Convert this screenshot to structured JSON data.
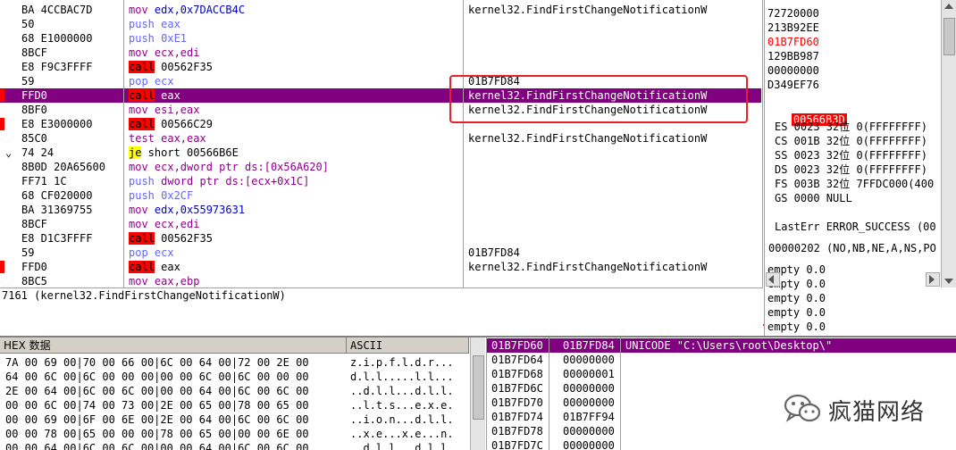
{
  "disasm": {
    "rows": [
      {
        "addr_hex": "BA 4CCBAC7D",
        "instr": [
          [
            "mov ",
            "kw"
          ],
          [
            "edx,0x7DACCB4C",
            "blue"
          ]
        ],
        "comment": "kernel32.FindFirstChangeNotificationW",
        "bp": false,
        "sel": false
      },
      {
        "addr_hex": "50",
        "instr": [
          [
            "push eax",
            "push"
          ]
        ],
        "comment": "",
        "bp": false,
        "sel": false
      },
      {
        "addr_hex": "68 E1000000",
        "instr": [
          [
            "push 0xE1",
            "push"
          ]
        ],
        "comment": "",
        "bp": false,
        "sel": false
      },
      {
        "addr_hex": "8BCF",
        "instr": [
          [
            "mov ecx,edi",
            "kw"
          ]
        ],
        "comment": "",
        "bp": false,
        "sel": false
      },
      {
        "addr_hex": "E8 F9C3FFFF",
        "instr": [
          [
            "call",
            "call"
          ],
          [
            " 00562F35",
            ""
          ]
        ],
        "comment": "",
        "bp": false,
        "sel": false
      },
      {
        "addr_hex": "59",
        "instr": [
          [
            "pop ecx",
            "push"
          ]
        ],
        "comment": "01B7FD84",
        "bp": false,
        "sel": false
      },
      {
        "addr_hex": "FFD0",
        "instr": [
          [
            "call",
            "call"
          ],
          [
            " eax",
            ""
          ]
        ],
        "comment": "kernel32.FindFirstChangeNotificationW",
        "bp": true,
        "sel": true
      },
      {
        "addr_hex": "8BF0",
        "instr": [
          [
            "mov esi,eax",
            "kw"
          ]
        ],
        "comment": "kernel32.FindFirstChangeNotificationW",
        "bp": false,
        "sel": false
      },
      {
        "addr_hex": "E8 E3000000",
        "instr": [
          [
            "call",
            "call"
          ],
          [
            " 00566C29",
            ""
          ]
        ],
        "comment": "",
        "bp": true,
        "sel": false
      },
      {
        "addr_hex": "85C0",
        "instr": [
          [
            "test eax,eax",
            "kw"
          ]
        ],
        "comment": "kernel32.FindFirstChangeNotificationW",
        "bp": false,
        "sel": false
      },
      {
        "addr_hex": "74 24",
        "instr": [
          [
            "je",
            "jcc"
          ],
          [
            " short 00566B6E",
            ""
          ]
        ],
        "comment": "",
        "bp": false,
        "sel": false
      },
      {
        "addr_hex": "8B0D 20A65600",
        "instr": [
          [
            "mov ",
            "kw"
          ],
          [
            "ecx,dword ptr ds:[0x56A620]",
            "kw"
          ]
        ],
        "comment": "",
        "bp": false,
        "sel": false
      },
      {
        "addr_hex": "FF71 1C",
        "instr": [
          [
            "push ",
            "push"
          ],
          [
            "dword ptr ds:[ecx+0x1C]",
            "kw"
          ]
        ],
        "comment": "",
        "bp": false,
        "sel": false
      },
      {
        "addr_hex": "68 CF020000",
        "instr": [
          [
            "push 0x2CF",
            "push"
          ]
        ],
        "comment": "",
        "bp": false,
        "sel": false
      },
      {
        "addr_hex": "BA 31369755",
        "instr": [
          [
            "mov ",
            "kw"
          ],
          [
            "edx,0x55973631",
            "blue"
          ]
        ],
        "comment": "",
        "bp": false,
        "sel": false
      },
      {
        "addr_hex": "8BCF",
        "instr": [
          [
            "mov ecx,edi",
            "kw"
          ]
        ],
        "comment": "",
        "bp": false,
        "sel": false
      },
      {
        "addr_hex": "E8 D1C3FFFF",
        "instr": [
          [
            "call",
            "call"
          ],
          [
            " 00562F35",
            ""
          ]
        ],
        "comment": "",
        "bp": false,
        "sel": false
      },
      {
        "addr_hex": "59",
        "instr": [
          [
            "pop ecx",
            "push"
          ]
        ],
        "comment": "01B7FD84",
        "bp": false,
        "sel": false
      },
      {
        "addr_hex": "FFD0",
        "instr": [
          [
            "call",
            "call"
          ],
          [
            " eax",
            ""
          ]
        ],
        "comment": "kernel32.FindFirstChangeNotificationW",
        "bp": true,
        "sel": false
      },
      {
        "addr_hex": "8BC5",
        "instr": [
          [
            "mov eax,ebp",
            "kw"
          ]
        ],
        "comment": "",
        "bp": false,
        "sel": false
      }
    ]
  },
  "registers": {
    "stack_vals": [
      "72720000",
      "213B92EE",
      "01B7FD60",
      "129BB987",
      "00000000",
      "D349EF76"
    ],
    "stack_red_index": 2,
    "eip_label": "00566B3D",
    "segments": [
      "ES 0023 32位 0(FFFFFFFF)",
      "CS 001B 32位 0(FFFFFFFF)",
      "SS 0023 32位 0(FFFFFFFF)",
      "DS 0023 32位 0(FFFFFFFF)",
      "FS 003B 32位 7FFDC000(400",
      "GS 0000 NULL"
    ],
    "lasterr": "LastErr ERROR_SUCCESS (00",
    "flags": "00000202 (NO,NB,NE,A,NS,PO",
    "fpu": [
      "empty 0.0",
      "empty 0.0",
      "empty 0.0",
      "empty 0.0",
      "empty 0.0"
    ]
  },
  "info_line": "7161 (kernel32.FindFirstChangeNotificationW)",
  "hexdump": {
    "header_hex": "HEX 数据",
    "header_ascii": "ASCII",
    "rows": [
      {
        "hex": "7A 00 69 00|70 00 66 00|6C 00 64 00|72 00 2E 00",
        "ascii": "z.i.p.f.l.d.r..."
      },
      {
        "hex": "64 00 6C 00|6C 00 00 00|00 00 6C 00|6C 00 00 00",
        "ascii": "d.l.l.....l.l..."
      },
      {
        "hex": "2E 00 64 00|6C 00 6C 00|00 00 64 00|6C 00 6C 00",
        "ascii": "..d.l.l...d.l.l."
      },
      {
        "hex": "00 00 6C 00|74 00 73 00|2E 00 65 00|78 00 65 00",
        "ascii": "..l.t.s...e.x.e."
      },
      {
        "hex": "00 00 69 00|6F 00 6E 00|2E 00 64 00|6C 00 6C 00",
        "ascii": "..i.o.n...d.l.l."
      },
      {
        "hex": "00 00 78 00|65 00 00 00|78 00 65 00|00 00 6E 00",
        "ascii": "..x.e...x.e...n."
      },
      {
        "hex": "00 00 64 00|6C 00 6C 00|00 00 64 00|6C 00 6C 00",
        "ascii": "..d.l.l...d.l.l."
      }
    ]
  },
  "stack": {
    "rows": [
      {
        "addr": "01B7FD60",
        "val": "01B7FD84",
        "comment": "UNICODE \"C:\\Users\\root\\Desktop\\\"",
        "sel": true
      },
      {
        "addr": "01B7FD64",
        "val": "00000000",
        "comment": "",
        "sel": false
      },
      {
        "addr": "01B7FD68",
        "val": "00000001",
        "comment": "",
        "sel": false
      },
      {
        "addr": "01B7FD6C",
        "val": "00000000",
        "comment": "",
        "sel": false
      },
      {
        "addr": "01B7FD70",
        "val": "00000000",
        "comment": "",
        "sel": false
      },
      {
        "addr": "01B7FD74",
        "val": "01B7FF94",
        "comment": "",
        "sel": false
      },
      {
        "addr": "01B7FD78",
        "val": "00000000",
        "comment": "",
        "sel": false
      },
      {
        "addr": "01B7FD7C",
        "val": "00000000",
        "comment": "",
        "sel": false
      }
    ]
  },
  "watermark": {
    "text": "疯猫网络"
  },
  "colors": {
    "selection": "#800080",
    "call_bg": "#ff0000",
    "jcc_bg": "#ffff00",
    "annotation_box": "#e8202a"
  }
}
